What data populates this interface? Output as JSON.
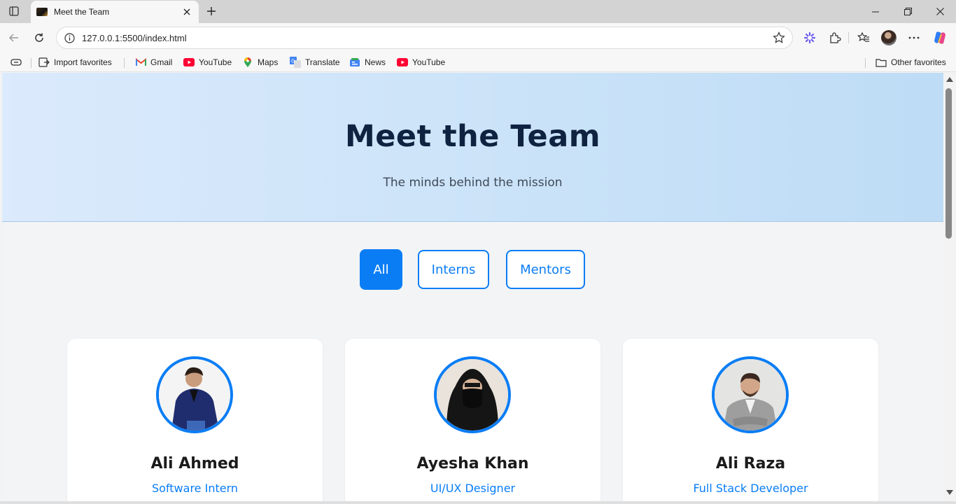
{
  "browser": {
    "tab_title": "Meet the Team",
    "url": "127.0.0.1:5500/index.html",
    "bookmarks": [
      {
        "label": "Import favorites",
        "icon": "import-favorites-icon"
      },
      {
        "label": "Gmail",
        "icon": "gmail-icon"
      },
      {
        "label": "YouTube",
        "icon": "youtube-icon"
      },
      {
        "label": "Maps",
        "icon": "maps-icon"
      },
      {
        "label": "Translate",
        "icon": "translate-icon"
      },
      {
        "label": "News",
        "icon": "news-icon"
      },
      {
        "label": "YouTube",
        "icon": "youtube-icon"
      }
    ],
    "other_favorites": "Other favorites"
  },
  "hero": {
    "title": "Meet the Team",
    "subtitle": "The minds behind the mission"
  },
  "filters": [
    {
      "label": "All",
      "active": true
    },
    {
      "label": "Interns",
      "active": false
    },
    {
      "label": "Mentors",
      "active": false
    }
  ],
  "team": [
    {
      "name": "Ali Ahmed",
      "role": "Software Intern"
    },
    {
      "name": "Ayesha Khan",
      "role": "UI/UX Designer"
    },
    {
      "name": "Ali Raza",
      "role": "Full Stack Developer"
    }
  ],
  "colors": {
    "accent": "#0a7df5",
    "hero_title": "#0f2340",
    "youtube_red": "#ff0033"
  }
}
